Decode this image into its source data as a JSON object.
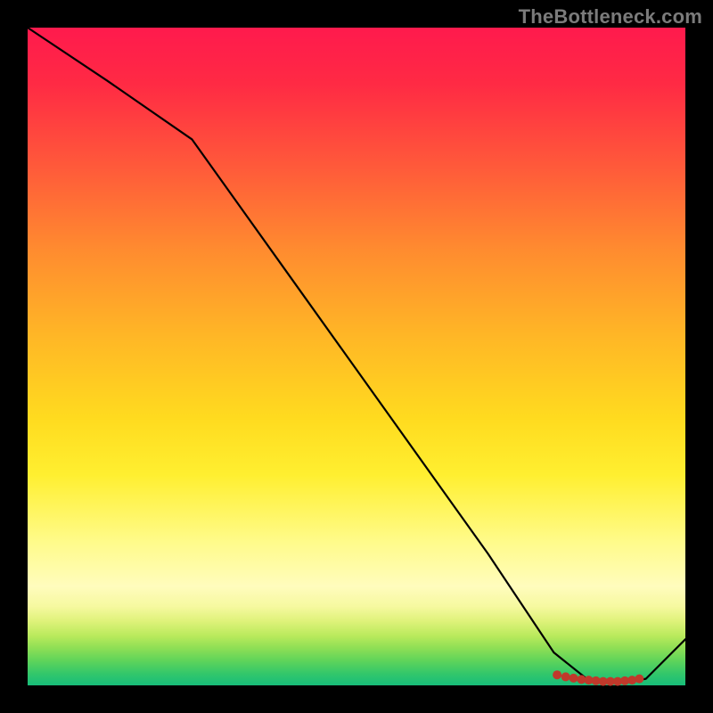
{
  "attribution": "TheBottleneck.com",
  "chart_data": {
    "type": "line",
    "title": "",
    "xlabel": "",
    "ylabel": "",
    "xlim": [
      0,
      100
    ],
    "ylim": [
      0,
      100
    ],
    "grid": false,
    "legend": false,
    "series": [
      {
        "name": "curve",
        "x": [
          0,
          12,
          25,
          40,
          55,
          70,
          80,
          85,
          88,
          91,
          94,
          100
        ],
        "y": [
          100,
          92,
          83,
          62,
          41,
          20,
          5,
          1,
          0.5,
          0.5,
          1,
          7
        ],
        "stroke": "#000000",
        "width": 2.2
      }
    ],
    "markers": {
      "name": "bottom-cluster",
      "points": [
        {
          "x": 80.5,
          "y": 1.6
        },
        {
          "x": 81.8,
          "y": 1.3
        },
        {
          "x": 83.0,
          "y": 1.1
        },
        {
          "x": 84.2,
          "y": 0.9
        },
        {
          "x": 85.3,
          "y": 0.8
        },
        {
          "x": 86.4,
          "y": 0.7
        },
        {
          "x": 87.5,
          "y": 0.6
        },
        {
          "x": 88.6,
          "y": 0.6
        },
        {
          "x": 89.7,
          "y": 0.6
        },
        {
          "x": 90.8,
          "y": 0.7
        },
        {
          "x": 91.9,
          "y": 0.8
        },
        {
          "x": 93.0,
          "y": 1.0
        }
      ],
      "fill": "#c0392b",
      "radius": 5
    }
  }
}
